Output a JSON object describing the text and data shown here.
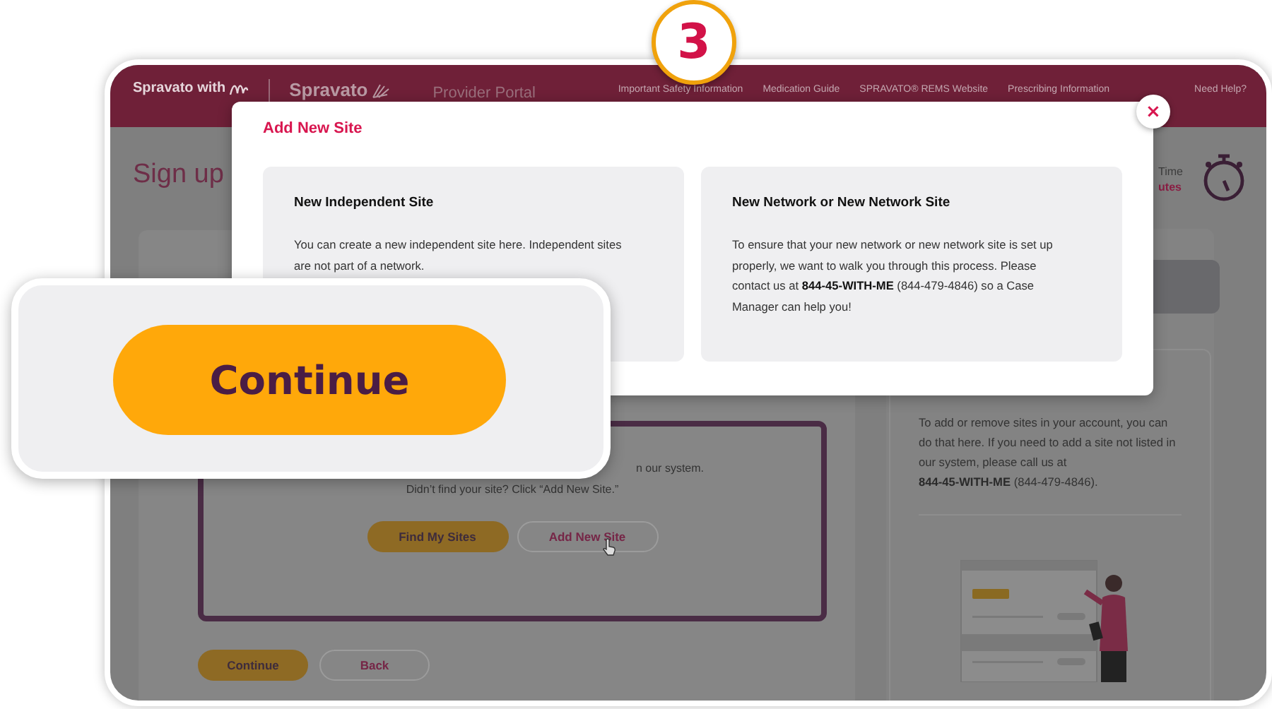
{
  "badge": {
    "label": "3"
  },
  "header": {
    "logo_text": "Spravato with",
    "brand": "Spravato",
    "title": "Provider Portal",
    "nav": [
      "Important Safety Information",
      "Medication Guide",
      "SPRAVATO® REMS Website",
      "Prescribing Information",
      "Need Help?"
    ]
  },
  "page": {
    "title": "Sign up",
    "time_label": "Time",
    "time_value": "utes",
    "site_search": {
      "lines": [
        "n our system.",
        "Didn’t find your site? Click “Add New Site.”"
      ],
      "buttons": [
        {
          "label": "Find My Sites",
          "kind": "primary"
        },
        {
          "label": "Add New Site",
          "kind": "secondary"
        }
      ]
    },
    "footer_buttons": [
      {
        "label": "Continue",
        "kind": "primary"
      },
      {
        "label": "Back",
        "kind": "secondary"
      }
    ],
    "help": {
      "text": "To add or remove sites in your account, you can do that here. If you need to add a site not listed in our system, please call us at",
      "phone": "**844-45-WITH-ME** (844-479-4846)."
    }
  },
  "modal": {
    "title": "Add New Site",
    "close": "×",
    "options": [
      {
        "title": "New Independent Site",
        "text": "You can create a new independent site here. Independent sites are not part of a network."
      },
      {
        "title": "New Network or New Network Site",
        "text": "To ensure that your new network or new network site is set up properly, we want to walk you through this process. Please contact us at **844-45-WITH-ME** (844-479-4846) so a Case Manager can help you!"
      }
    ]
  },
  "callout": {
    "button": "Continue"
  }
}
